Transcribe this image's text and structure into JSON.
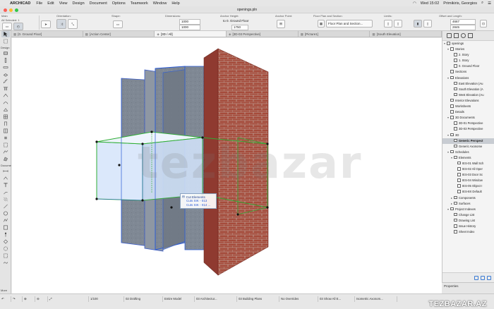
{
  "menubar": {
    "app": "ARCHICAD",
    "items": [
      "File",
      "Edit",
      "View",
      "Design",
      "Document",
      "Options",
      "Teamwork",
      "Window",
      "Help"
    ],
    "clock": "Wed 15:02",
    "user": "Primikiris, Georgios"
  },
  "window": {
    "title": "openings.pln"
  },
  "infobox": {
    "main_label": "Main",
    "selection": "All Selected: 1",
    "orientation_label": "Orientation:",
    "shape_label": "Shape:",
    "dimensions_label": "Dimensions:",
    "dim_w": "1000",
    "dim_h": "1000",
    "anchor_height_label": "Anchor Height:",
    "anchor_value": "to 0. Ground Floor",
    "anchor_num": "1750",
    "anchor_point_label": "Anchor Point:",
    "floor_plan_label": "Floor Plan and Section:",
    "floor_plan_value": "Floor Plan and Section...",
    "limits_label": "Limits:",
    "offset_label": "Offset and Length:",
    "offset_1": "4667",
    "offset_2": "2845"
  },
  "tabs": [
    {
      "icon": "▦",
      "label": "[0. Ground Floor]"
    },
    {
      "icon": "▦",
      "label": "[Action Center]"
    },
    {
      "icon": "◈",
      "label": "[3D / All]"
    },
    {
      "icon": "◈",
      "label": "[3D-03 Perspective]"
    },
    {
      "icon": "▦",
      "label": "[Picture1]"
    },
    {
      "icon": "▦",
      "label": "[South Elevation]"
    }
  ],
  "toolbox": {
    "section_design": "Design",
    "section_document": "Docume",
    "more": "More"
  },
  "scene": {
    "watermark": "tezbazar",
    "popup_title": "Cut Elements",
    "popup_item_1": "Cuts SIK - 013",
    "popup_item_2": "Cuts SIK - 014",
    "popup_item_3": "..."
  },
  "navigator": [
    {
      "level": 0,
      "arrow": "▾",
      "label": "openings",
      "sel": false
    },
    {
      "level": 1,
      "arrow": "▾",
      "label": "Stories",
      "sel": false
    },
    {
      "level": 2,
      "arrow": "",
      "label": "2. Story",
      "sel": false
    },
    {
      "level": 2,
      "arrow": "",
      "label": "1. Story",
      "sel": false
    },
    {
      "level": 2,
      "arrow": "",
      "label": "0. Ground Floor",
      "sel": false
    },
    {
      "level": 1,
      "arrow": "",
      "label": "Sections",
      "sel": false
    },
    {
      "level": 1,
      "arrow": "▾",
      "label": "Elevations",
      "sel": false
    },
    {
      "level": 2,
      "arrow": "",
      "label": "East Elevation (Au",
      "sel": false
    },
    {
      "level": 2,
      "arrow": "",
      "label": "South Elevation (A",
      "sel": false
    },
    {
      "level": 2,
      "arrow": "",
      "label": "West Elevation (Au",
      "sel": false
    },
    {
      "level": 1,
      "arrow": "",
      "label": "Interior Elevations",
      "sel": false
    },
    {
      "level": 1,
      "arrow": "",
      "label": "Worksheets",
      "sel": false
    },
    {
      "level": 1,
      "arrow": "",
      "label": "Details",
      "sel": false
    },
    {
      "level": 1,
      "arrow": "▾",
      "label": "3D Documents",
      "sel": false
    },
    {
      "level": 2,
      "arrow": "",
      "label": "3D-01 Perspective",
      "sel": false
    },
    {
      "level": 2,
      "arrow": "",
      "label": "3D-03 Perspective",
      "sel": false
    },
    {
      "level": 1,
      "arrow": "▾",
      "label": "3D",
      "sel": false
    },
    {
      "level": 2,
      "arrow": "",
      "label": "Generic Perspect",
      "sel": true
    },
    {
      "level": 2,
      "arrow": "",
      "label": "Generic Axonome",
      "sel": false
    },
    {
      "level": 1,
      "arrow": "▾",
      "label": "Schedules",
      "sel": false
    },
    {
      "level": 2,
      "arrow": "▾",
      "label": "Elements",
      "sel": false
    },
    {
      "level": 3,
      "arrow": "",
      "label": "IES-01 Wall Sch",
      "sel": false
    },
    {
      "level": 3,
      "arrow": "",
      "label": "IES-02 All Oper",
      "sel": false
    },
    {
      "level": 3,
      "arrow": "",
      "label": "IES-03 Door Sc",
      "sel": false
    },
    {
      "level": 3,
      "arrow": "",
      "label": "IES-04 Window",
      "sel": false
    },
    {
      "level": 3,
      "arrow": "",
      "label": "IES-05 Object I",
      "sel": false
    },
    {
      "level": 3,
      "arrow": "",
      "label": "IES-8X Default",
      "sel": false
    },
    {
      "level": 2,
      "arrow": "▸",
      "label": "Components",
      "sel": false
    },
    {
      "level": 2,
      "arrow": "▸",
      "label": "Surfaces",
      "sel": false
    },
    {
      "level": 1,
      "arrow": "▾",
      "label": "Project Indexes",
      "sel": false
    },
    {
      "level": 2,
      "arrow": "",
      "label": "Change List",
      "sel": false
    },
    {
      "level": 2,
      "arrow": "",
      "label": "Drawing List",
      "sel": false
    },
    {
      "level": 2,
      "arrow": "",
      "label": "Issue History",
      "sel": false
    },
    {
      "level": 2,
      "arrow": "",
      "label": "Sheet Index",
      "sel": false
    }
  ],
  "properties": {
    "label": "Properties"
  },
  "status": [
    "1/100",
    "02 Drafting",
    "Entire Model",
    "03 Architectur...",
    "03 Building Plans",
    "No Overrides",
    "03 Show All E...",
    "Isometric Axonom..."
  ],
  "brand": "TEZBAZAR.AZ",
  "colors": {
    "brick": "#a8473b",
    "mortar": "#d9cfc6",
    "selection_blue": "#2a5bd7",
    "opening_green": "#2fae35",
    "glass": "#dbe8fb",
    "wall_grey": "#7f8894"
  }
}
